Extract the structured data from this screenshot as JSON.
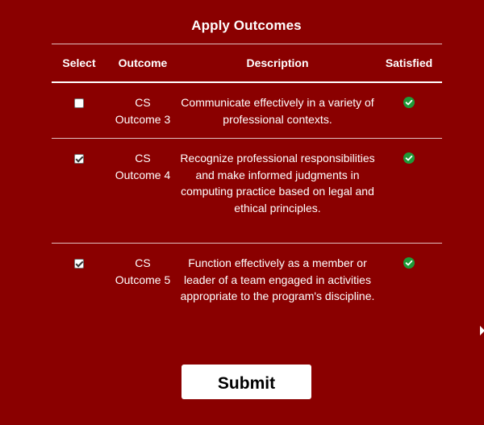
{
  "title": "Apply Outcomes",
  "table": {
    "headers": {
      "select": "Select",
      "outcome": "Outcome",
      "description": "Description",
      "satisfied": "Satisfied"
    },
    "rows": [
      {
        "checked": false,
        "outcome_line1": "CS",
        "outcome_line2": "Outcome 3",
        "description": "Communicate effectively in a variety of professional contexts.",
        "satisfied": true
      },
      {
        "checked": true,
        "outcome_line1": "CS",
        "outcome_line2": "Outcome 4",
        "description": "Recognize professional responsibilities and make informed judgments in computing practice based on legal and ethical principles.",
        "satisfied": true
      },
      {
        "checked": true,
        "outcome_line1": "CS",
        "outcome_line2": "Outcome 5",
        "description": "Function effectively as a member or leader of a team engaged in activities appropriate to the program's discipline.",
        "satisfied": true
      }
    ]
  },
  "submit_label": "Submit",
  "colors": {
    "background": "#8a0000",
    "satisfied_icon": "#1e9a38"
  },
  "icons": {
    "satisfied": "check-circle-icon",
    "edge": "arrow-right-icon"
  }
}
